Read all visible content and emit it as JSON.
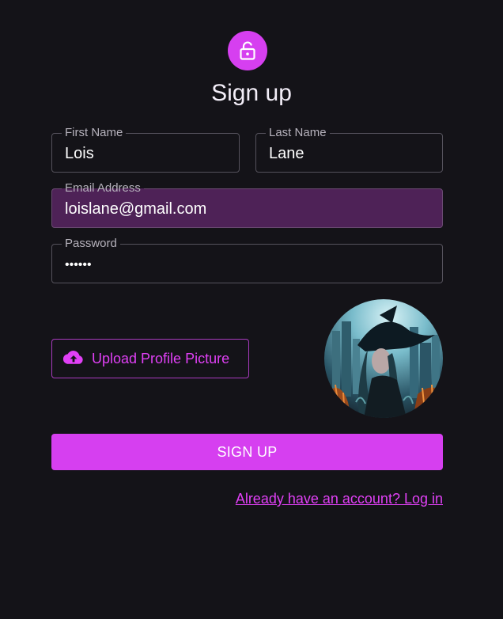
{
  "title": "Sign up",
  "icons": {
    "header": "lock-open-icon",
    "upload": "cloud-upload-icon"
  },
  "colors": {
    "accent": "#d63ff0",
    "background": "#141318",
    "autofill": "#4e2257",
    "link": "#e040f5"
  },
  "form": {
    "first_name": {
      "label": "First Name",
      "value": "Lois"
    },
    "last_name": {
      "label": "Last Name",
      "value": "Lane"
    },
    "email": {
      "label": "Email Address",
      "value": "loislane@gmail.com"
    },
    "password": {
      "label": "Password",
      "value": "••••••"
    }
  },
  "upload_button": {
    "label": "Upload Profile Picture"
  },
  "submit_button": {
    "label": "SIGN UP"
  },
  "login_link": {
    "label": "Already have an account? Log in"
  }
}
